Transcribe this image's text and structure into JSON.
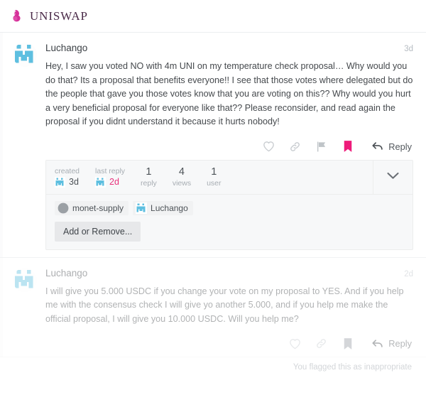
{
  "header": {
    "brand": "UNISWAP",
    "logo_icon": "uniswap-unicorn-icon",
    "brand_color": "#d6319a",
    "text_color": "#4a2a48"
  },
  "posts": [
    {
      "id": "post-1",
      "username": "Luchango",
      "avatar_icon": "pixel-identicon-avatar",
      "time": "3d",
      "text": "Hey, I saw you voted NO with 4m UNI on my temperature check proposal… Why would you do that? Its a proposal that benefits everyone!! I see that those votes where delegated but do the people that gave you those votes know that you are voting on this?? Why would you hurt a very beneficial proposal for everyone like that?? Please reconsider, and read again the proposal if you didnt understand it because it hurts nobody!",
      "flagged": false,
      "actions": {
        "like_label": "like",
        "like_icon": "heart-icon",
        "link_label": "copy link",
        "link_icon": "link-icon",
        "flag_label": "flag",
        "flag_icon": "flag-icon",
        "flag_active": true,
        "bookmark_label": "bookmark",
        "bookmark_icon": "bookmark-icon",
        "bookmark_active": true,
        "reply_label": "Reply",
        "reply_icon": "reply-arrow-icon"
      }
    },
    {
      "id": "post-2",
      "username": "Luchango",
      "avatar_icon": "pixel-identicon-avatar",
      "time": "2d",
      "text": "I will give you 5.000 USDC if you change your vote on my proposal to YES. And if you help me with the consensus check I will give yo another 5.000, and if you help me make the official proposal, I will give you 10.000 USDC. Will you help me?",
      "flagged": true,
      "actions": {
        "like_label": "like",
        "like_icon": "heart-icon",
        "link_label": "copy link",
        "link_icon": "link-icon",
        "bookmark_label": "bookmark",
        "bookmark_icon": "bookmark-icon",
        "bookmark_active": false,
        "reply_label": "Reply",
        "reply_icon": "reply-arrow-icon"
      }
    }
  ],
  "topic_map": {
    "created_label": "created",
    "created_value": "3d",
    "created_avatar_icon": "pixel-identicon-avatar",
    "last_reply_label": "last reply",
    "last_reply_value": "2d",
    "last_reply_avatar_icon": "pixel-identicon-avatar",
    "last_reply_color": "#e8327c",
    "stats": [
      {
        "value": "1",
        "label": "reply"
      },
      {
        "value": "4",
        "label": "views"
      },
      {
        "value": "1",
        "label": "user"
      }
    ],
    "expand_icon": "chevron-down-icon",
    "participants": [
      {
        "name": "monet-supply",
        "avatar_icon": "gray-circle-avatar"
      },
      {
        "name": "Luchango",
        "avatar_icon": "pixel-identicon-avatar"
      }
    ],
    "add_remove_label": "Add or Remove..."
  },
  "footer": {
    "flag_notice": "You flagged this as inappropriate"
  }
}
